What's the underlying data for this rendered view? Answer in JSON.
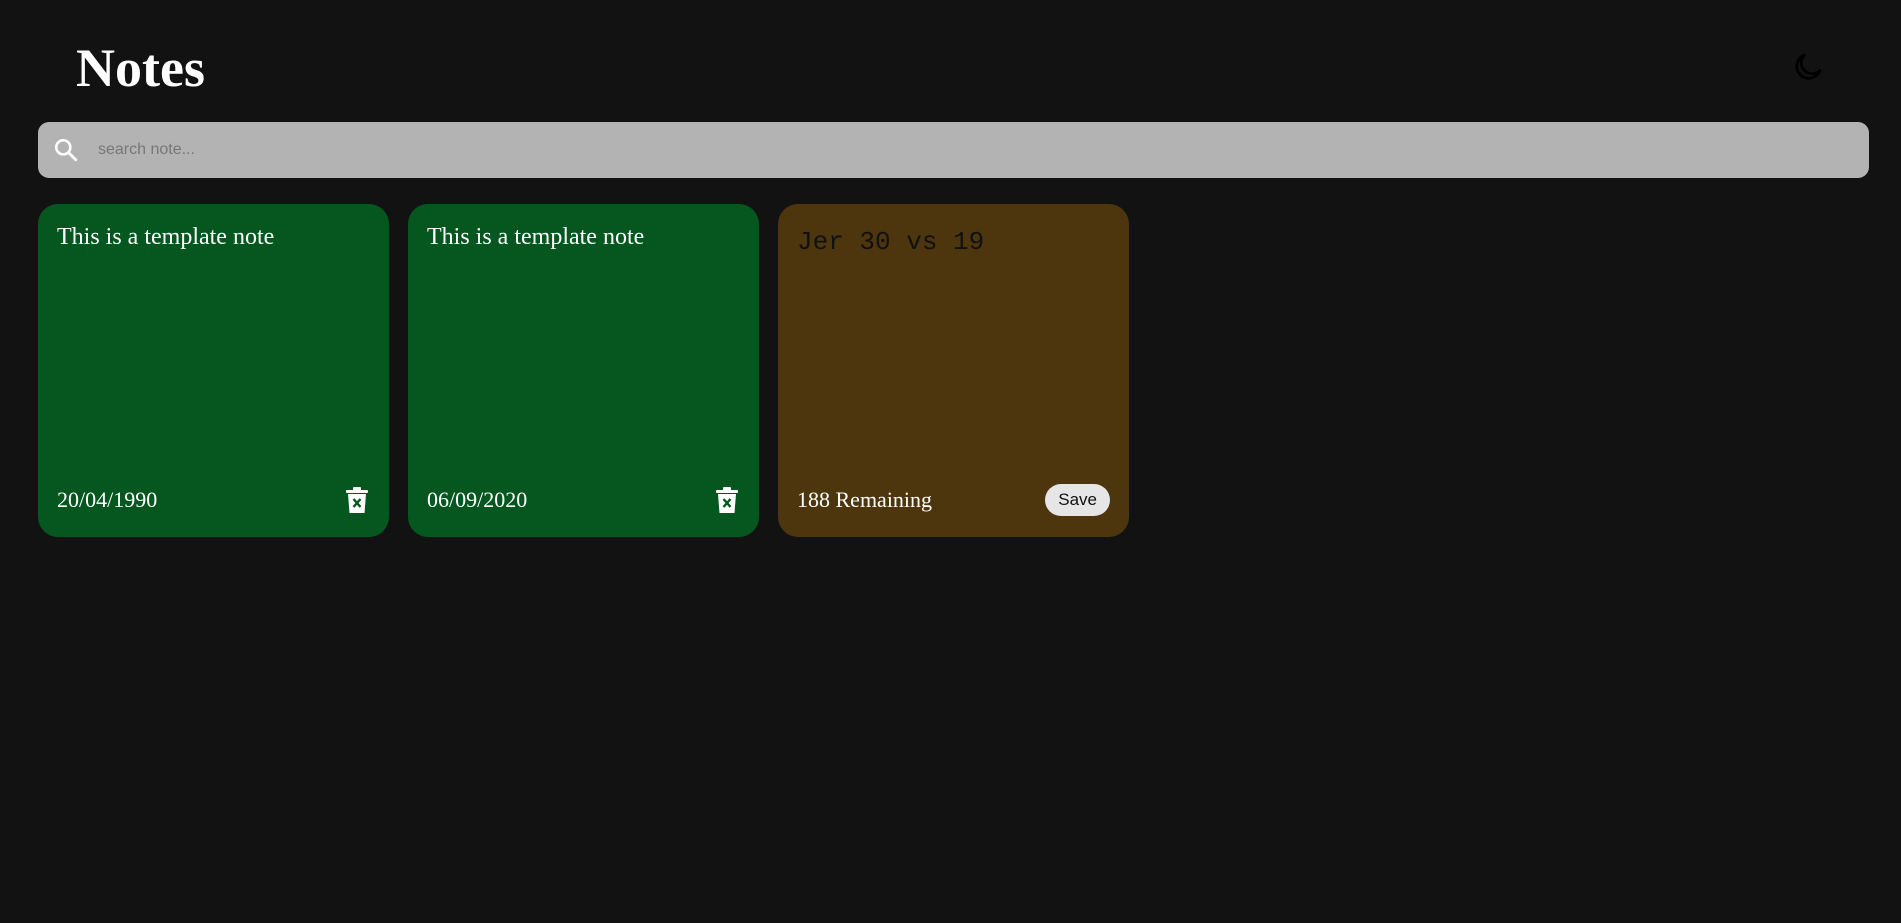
{
  "header": {
    "title": "Notes",
    "theme_toggle_icon": "moon-icon"
  },
  "search": {
    "placeholder": "search note...",
    "value": "",
    "icon": "search-icon"
  },
  "notes": [
    {
      "text": "This is a template note",
      "date": "20/04/1990",
      "color": "#05571f",
      "action_icon": "trash-icon"
    },
    {
      "text": "This is a template note",
      "date": "06/09/2020",
      "color": "#05571f",
      "action_icon": "trash-icon"
    }
  ],
  "new_note": {
    "text": "Jer 30 vs 19",
    "remaining": "188 Remaining",
    "save_label": "Save",
    "color": "#4d350e"
  },
  "colors": {
    "background": "#121212",
    "search_bg": "#b3b3b3",
    "note_green": "#05571f",
    "note_brown": "#4d350e"
  }
}
